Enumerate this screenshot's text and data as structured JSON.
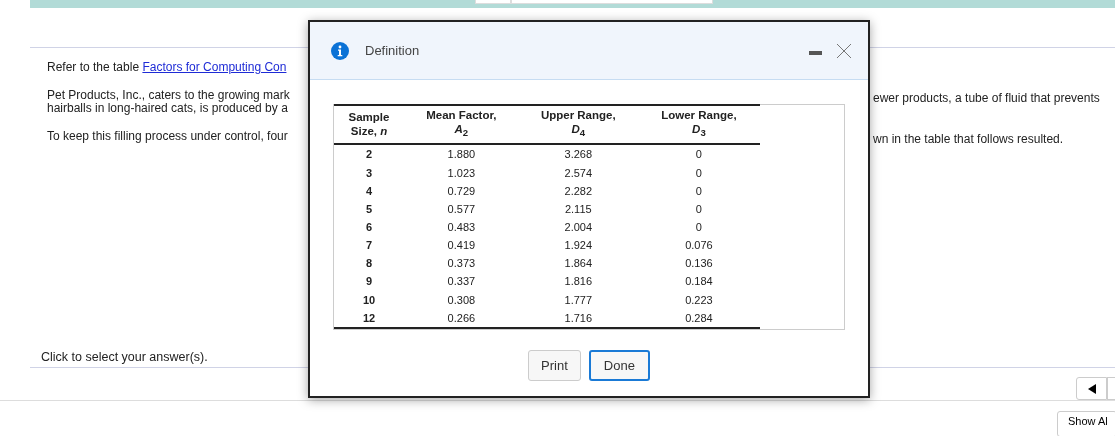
{
  "page": {
    "intro_text": "Refer to the table ",
    "intro_link": "Factors for Computing Con",
    "paragraphs": [
      {
        "left": [
          "Pet Products, Inc., caters to the growing mark",
          "hairballs in long-haired cats, is produced by a"
        ],
        "right": "ewer products, a tube of fluid that prevents"
      },
      {
        "left": [
          "To keep this filling process under control, four"
        ],
        "right": "wn in the table that follows resulted."
      }
    ],
    "prompt": "Click to select your answer(s).",
    "show_all_button": "Show Al"
  },
  "dialog": {
    "title": "Definition",
    "table": {
      "columns": [
        {
          "top": "Sample",
          "bottom": "Size, *n*"
        },
        {
          "top": "Mean Factor,",
          "bottom": "*A*$_{2}$"
        },
        {
          "top": "Upper Range,",
          "bottom": "*D*$_{4}$"
        },
        {
          "top": "Lower Range,",
          "bottom": "*D*$_{3}$"
        }
      ],
      "rows": [
        [
          "2",
          "1.880",
          "3.268",
          "0"
        ],
        [
          "3",
          "1.023",
          "2.574",
          "0"
        ],
        [
          "4",
          "0.729",
          "2.282",
          "0"
        ],
        [
          "5",
          "0.577",
          "2.115",
          "0"
        ],
        [
          "6",
          "0.483",
          "2.004",
          "0"
        ],
        [
          "7",
          "0.419",
          "1.924",
          "0.076"
        ],
        [
          "8",
          "0.373",
          "1.864",
          "0.136"
        ],
        [
          "9",
          "0.337",
          "1.816",
          "0.184"
        ],
        [
          "10",
          "0.308",
          "1.777",
          "0.223"
        ],
        [
          "12",
          "0.266",
          "1.716",
          "0.284"
        ]
      ]
    },
    "buttons": [
      {
        "label": "Print",
        "focused": false
      },
      {
        "label": "Done",
        "focused": true
      }
    ]
  }
}
